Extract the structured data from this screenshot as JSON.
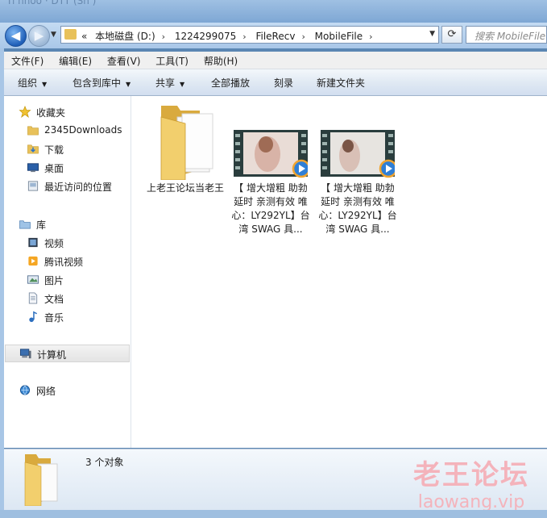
{
  "window": {
    "title": "Ti hhóo  · DTT (Sn )"
  },
  "address": {
    "crumbs": [
      "«",
      "本地磁盘 (D:)",
      "1224299075",
      "FileRecv",
      "MobileFile"
    ],
    "search_placeholder": "搜索 MobileFile"
  },
  "menu": [
    "文件(F)",
    "编辑(E)",
    "查看(V)",
    "工具(T)",
    "帮助(H)"
  ],
  "toolbar": {
    "organize": "组织",
    "include": "包含到库中",
    "share": "共享",
    "play_all": "全部播放",
    "burn": "刻录",
    "new_folder": "新建文件夹"
  },
  "nav": {
    "favorites": "收藏夹",
    "fav_items": [
      "2345Downloads",
      "下载",
      "桌面",
      "最近访问的位置"
    ],
    "libraries": "库",
    "lib_items": [
      "视频",
      "腾讯视频",
      "图片",
      "文档",
      "音乐"
    ],
    "computer": "计算机",
    "network": "网络"
  },
  "files": [
    {
      "name": "上老王论坛当老王",
      "type": "folder"
    },
    {
      "name": "【 增大增粗 助勃延时 亲测有效 唯心：LY292YL】台湾 SWAG 具...",
      "type": "video"
    },
    {
      "name": "【 增大增粗 助勃延时 亲测有效 唯心：LY292YL】台湾 SWAG 具...",
      "type": "video"
    }
  ],
  "status": {
    "count": "3 个对象"
  },
  "watermark": {
    "line1": "老王论坛",
    "line2": "laowang.vip"
  },
  "colors": {
    "accent": "#1f5fb8",
    "folder": "#e8c15a",
    "watermark": "#f4b3bb"
  }
}
